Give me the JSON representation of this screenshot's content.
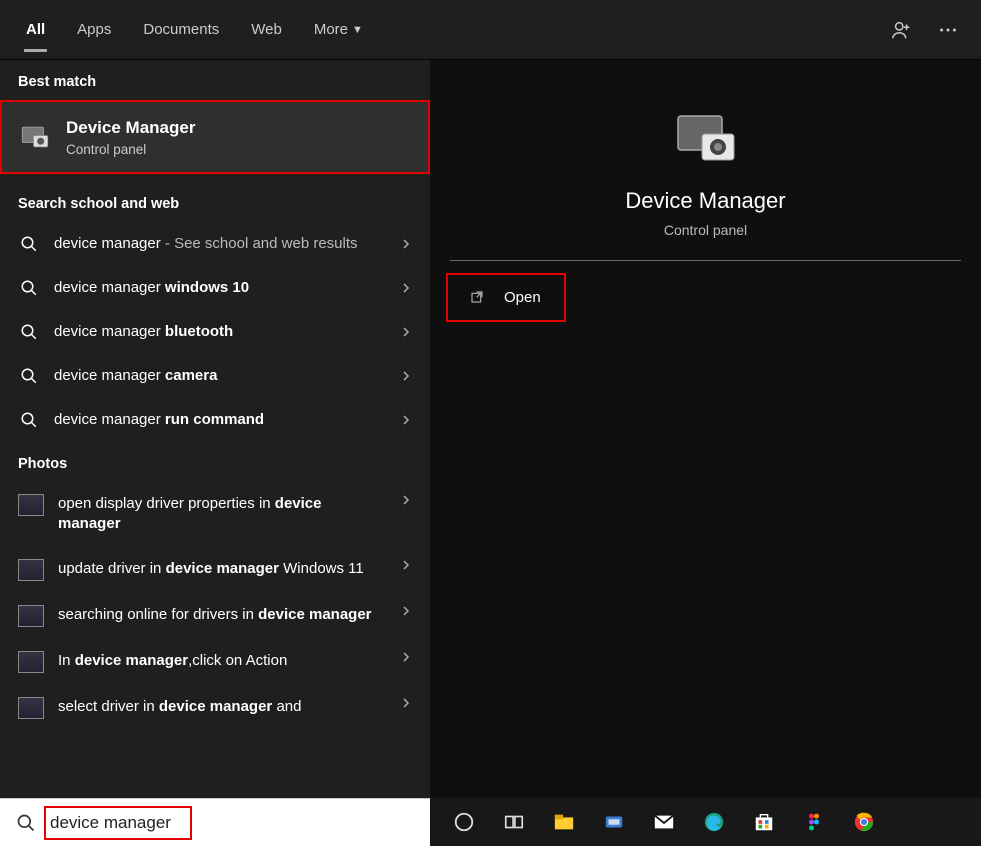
{
  "tabs": {
    "all": "All",
    "apps": "Apps",
    "documents": "Documents",
    "web": "Web",
    "more": "More"
  },
  "sections": {
    "best": "Best match",
    "web": "Search school and web",
    "photos": "Photos"
  },
  "best_match": {
    "title": "Device Manager",
    "subtitle": "Control panel"
  },
  "web_results": [
    {
      "prefix": "device manager",
      "bold": "",
      "hint": " - See school and web results"
    },
    {
      "prefix": "device manager ",
      "bold": "windows 10",
      "hint": ""
    },
    {
      "prefix": "device manager ",
      "bold": "bluetooth",
      "hint": ""
    },
    {
      "prefix": "device manager ",
      "bold": "camera",
      "hint": ""
    },
    {
      "prefix": "device manager ",
      "bold": "run command",
      "hint": ""
    }
  ],
  "photo_results": [
    {
      "html": "open display driver properties in <b>device manager</b>"
    },
    {
      "html": "update driver in <b>device manager</b> Windows 11"
    },
    {
      "html": "searching online for drivers in <b>device manager</b>"
    },
    {
      "html": "In <b>device manager</b>,click on Action"
    },
    {
      "html": "select driver in <b>device manager</b> and"
    }
  ],
  "preview": {
    "title": "Device Manager",
    "subtitle": "Control panel",
    "open": "Open"
  },
  "search": {
    "value": "device manager"
  }
}
